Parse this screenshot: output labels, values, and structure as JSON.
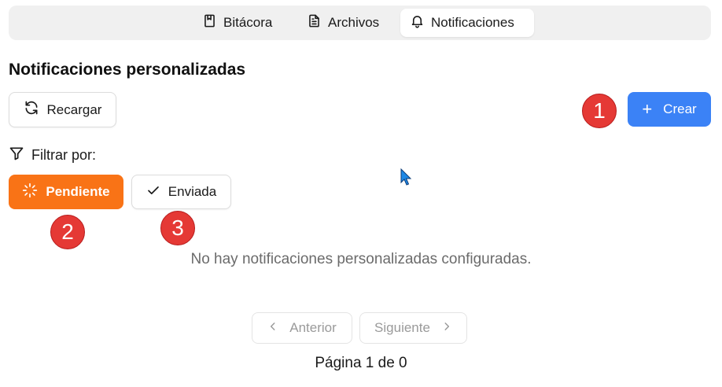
{
  "tabs": [
    {
      "label": "Bitácora",
      "icon": "book-icon",
      "active": false
    },
    {
      "label": "Archivos",
      "icon": "file-text-icon",
      "active": false
    },
    {
      "label": "Notificaciones",
      "icon": "bell-icon",
      "active": true
    }
  ],
  "page_title": "Notificaciones personalizadas",
  "toolbar": {
    "reload_label": "Recargar",
    "create_label": "Crear"
  },
  "filter": {
    "label": "Filtrar por:",
    "options": [
      {
        "label": "Pendiente",
        "icon": "loader-icon",
        "selected": true
      },
      {
        "label": "Enviada",
        "icon": "check-icon",
        "selected": false
      }
    ]
  },
  "annotations": [
    "1",
    "2",
    "3"
  ],
  "empty_message": "No hay notificaciones personalizadas configuradas.",
  "pagination": {
    "prev_label": "Anterior",
    "next_label": "Siguiente",
    "page_info": "Página 1 de 0"
  },
  "colors": {
    "accent_blue": "#3b82f6",
    "accent_orange": "#f97316",
    "marker_red": "#e53935"
  }
}
